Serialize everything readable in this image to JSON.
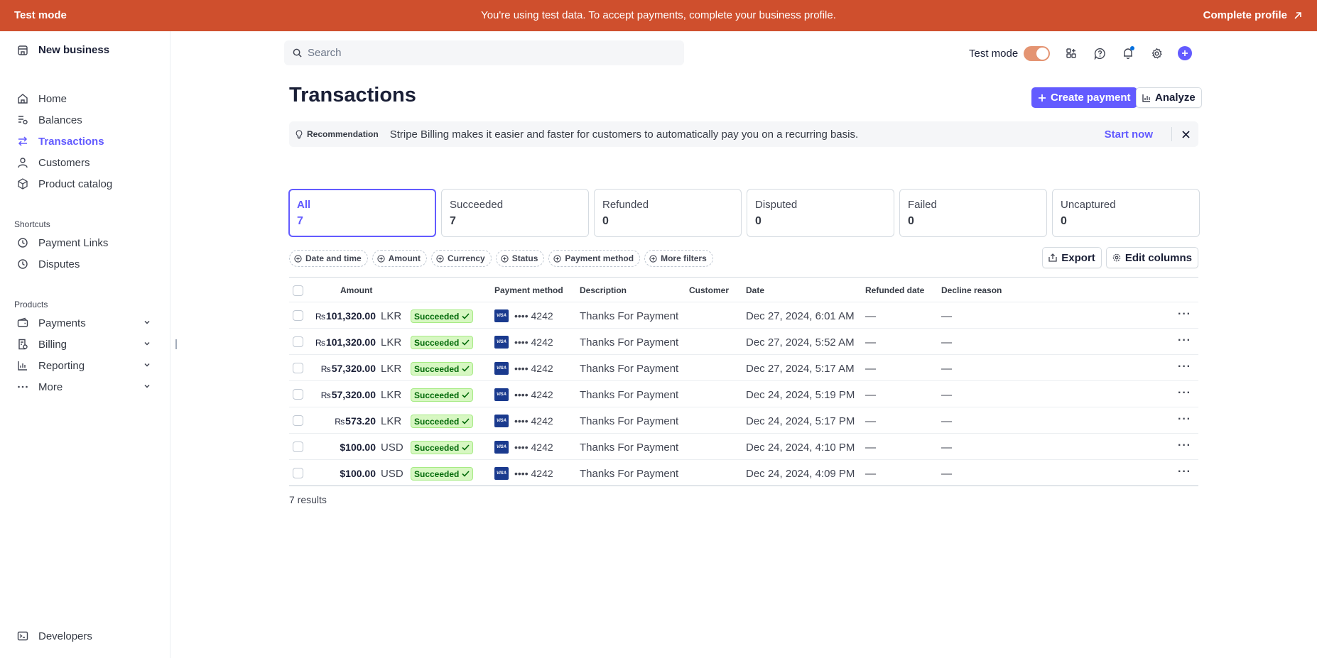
{
  "banner": {
    "mode_label": "Test mode",
    "message": "You're using test data. To accept payments, complete your business profile.",
    "cta": "Complete profile"
  },
  "sidebar": {
    "business": "New business",
    "main": [
      {
        "label": "Home",
        "icon": "home-icon"
      },
      {
        "label": "Balances",
        "icon": "balances-icon"
      },
      {
        "label": "Transactions",
        "icon": "transactions-icon",
        "active": true
      },
      {
        "label": "Customers",
        "icon": "customers-icon"
      },
      {
        "label": "Product catalog",
        "icon": "product-catalog-icon"
      }
    ],
    "shortcuts_label": "Shortcuts",
    "shortcuts": [
      {
        "label": "Payment Links",
        "icon": "clock-icon"
      },
      {
        "label": "Disputes",
        "icon": "clock-icon"
      }
    ],
    "products_label": "Products",
    "products": [
      {
        "label": "Payments",
        "icon": "payments-icon"
      },
      {
        "label": "Billing",
        "icon": "billing-icon"
      },
      {
        "label": "Reporting",
        "icon": "reporting-icon"
      },
      {
        "label": "More",
        "icon": "more-icon"
      }
    ],
    "developers": "Developers"
  },
  "topbar": {
    "search_placeholder": "Search",
    "test_mode_label": "Test mode",
    "test_mode_on": true
  },
  "header": {
    "title": "Transactions",
    "create_payment": "Create payment",
    "analyze": "Analyze"
  },
  "recommendation": {
    "tag": "Recommendation",
    "text": "Stripe Billing makes it easier and faster for customers to automatically pay you on a recurring basis.",
    "cta": "Start now"
  },
  "status_cards": [
    {
      "label": "All",
      "count": "7",
      "active": true
    },
    {
      "label": "Succeeded",
      "count": "7"
    },
    {
      "label": "Refunded",
      "count": "0"
    },
    {
      "label": "Disputed",
      "count": "0"
    },
    {
      "label": "Failed",
      "count": "0"
    },
    {
      "label": "Uncaptured",
      "count": "0"
    }
  ],
  "filters": [
    "Date and time",
    "Amount",
    "Currency",
    "Status",
    "Payment method",
    "More filters"
  ],
  "tools": {
    "export": "Export",
    "edit_columns": "Edit columns"
  },
  "table": {
    "columns": [
      "Amount",
      "Payment method",
      "Description",
      "Customer",
      "Date",
      "Refunded date",
      "Decline reason"
    ],
    "rows": [
      {
        "symbol": "₨",
        "amount": "101,320.00",
        "currency": "LKR",
        "status": "Succeeded",
        "card": "•••• 4242",
        "description": "Thanks For Payment",
        "customer": "",
        "date": "Dec 27, 2024, 6:01 AM",
        "refunded": "—",
        "decline": "—"
      },
      {
        "symbol": "₨",
        "amount": "101,320.00",
        "currency": "LKR",
        "status": "Succeeded",
        "card": "•••• 4242",
        "description": "Thanks For Payment",
        "customer": "",
        "date": "Dec 27, 2024, 5:52 AM",
        "refunded": "—",
        "decline": "—"
      },
      {
        "symbol": "₨",
        "amount": "57,320.00",
        "currency": "LKR",
        "status": "Succeeded",
        "card": "•••• 4242",
        "description": "Thanks For Payment",
        "customer": "",
        "date": "Dec 27, 2024, 5:17 AM",
        "refunded": "—",
        "decline": "—"
      },
      {
        "symbol": "₨",
        "amount": "57,320.00",
        "currency": "LKR",
        "status": "Succeeded",
        "card": "•••• 4242",
        "description": "Thanks For Payment",
        "customer": "",
        "date": "Dec 24, 2024, 5:19 PM",
        "refunded": "—",
        "decline": "—"
      },
      {
        "symbol": "₨",
        "amount": "573.20",
        "currency": "LKR",
        "status": "Succeeded",
        "card": "•••• 4242",
        "description": "Thanks For Payment",
        "customer": "",
        "date": "Dec 24, 2024, 5:17 PM",
        "refunded": "—",
        "decline": "—"
      },
      {
        "symbol": "",
        "amount": "$100.00",
        "currency": "USD",
        "status": "Succeeded",
        "card": "•••• 4242",
        "description": "Thanks For Payment",
        "customer": "",
        "date": "Dec 24, 2024, 4:10 PM",
        "refunded": "—",
        "decline": "—"
      },
      {
        "symbol": "",
        "amount": "$100.00",
        "currency": "USD",
        "status": "Succeeded",
        "card": "•••• 4242",
        "description": "Thanks For Payment",
        "customer": "",
        "date": "Dec 24, 2024, 4:09 PM",
        "refunded": "—",
        "decline": "—"
      }
    ],
    "card_brand": "VISA",
    "results": "7 results"
  },
  "colors": {
    "banner": "#cf4f2d",
    "accent": "#635bff",
    "success_bg": "#d7f7c2",
    "success_text": "#006908"
  }
}
